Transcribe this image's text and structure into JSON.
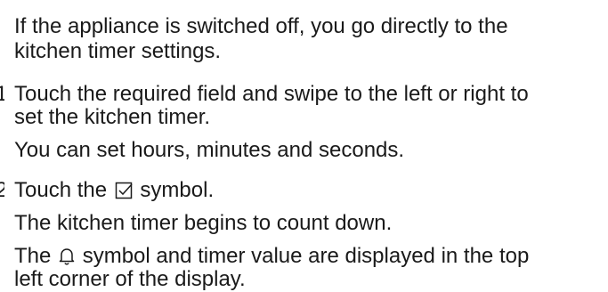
{
  "content": {
    "intro_line1": "If the appliance is switched off, you go directly to the",
    "intro_line2": "kitchen timer settings.",
    "step1": {
      "number": "1.",
      "line1": "Touch the required field and swipe to the left or right to",
      "line2": "set the kitchen timer.",
      "result": "You can set hours, minutes and seconds."
    },
    "step2": {
      "number": "2.",
      "text_before_icon": "Touch the",
      "icon": "checkmark-box-icon",
      "text_after_icon": "symbol.",
      "result1": "The kitchen timer begins to count down.",
      "result2_before_icon": "The",
      "result2_icon": "bell-icon",
      "result2_after_icon": "symbol and timer value are displayed in the top",
      "result2_line2": "left corner of the display."
    }
  }
}
